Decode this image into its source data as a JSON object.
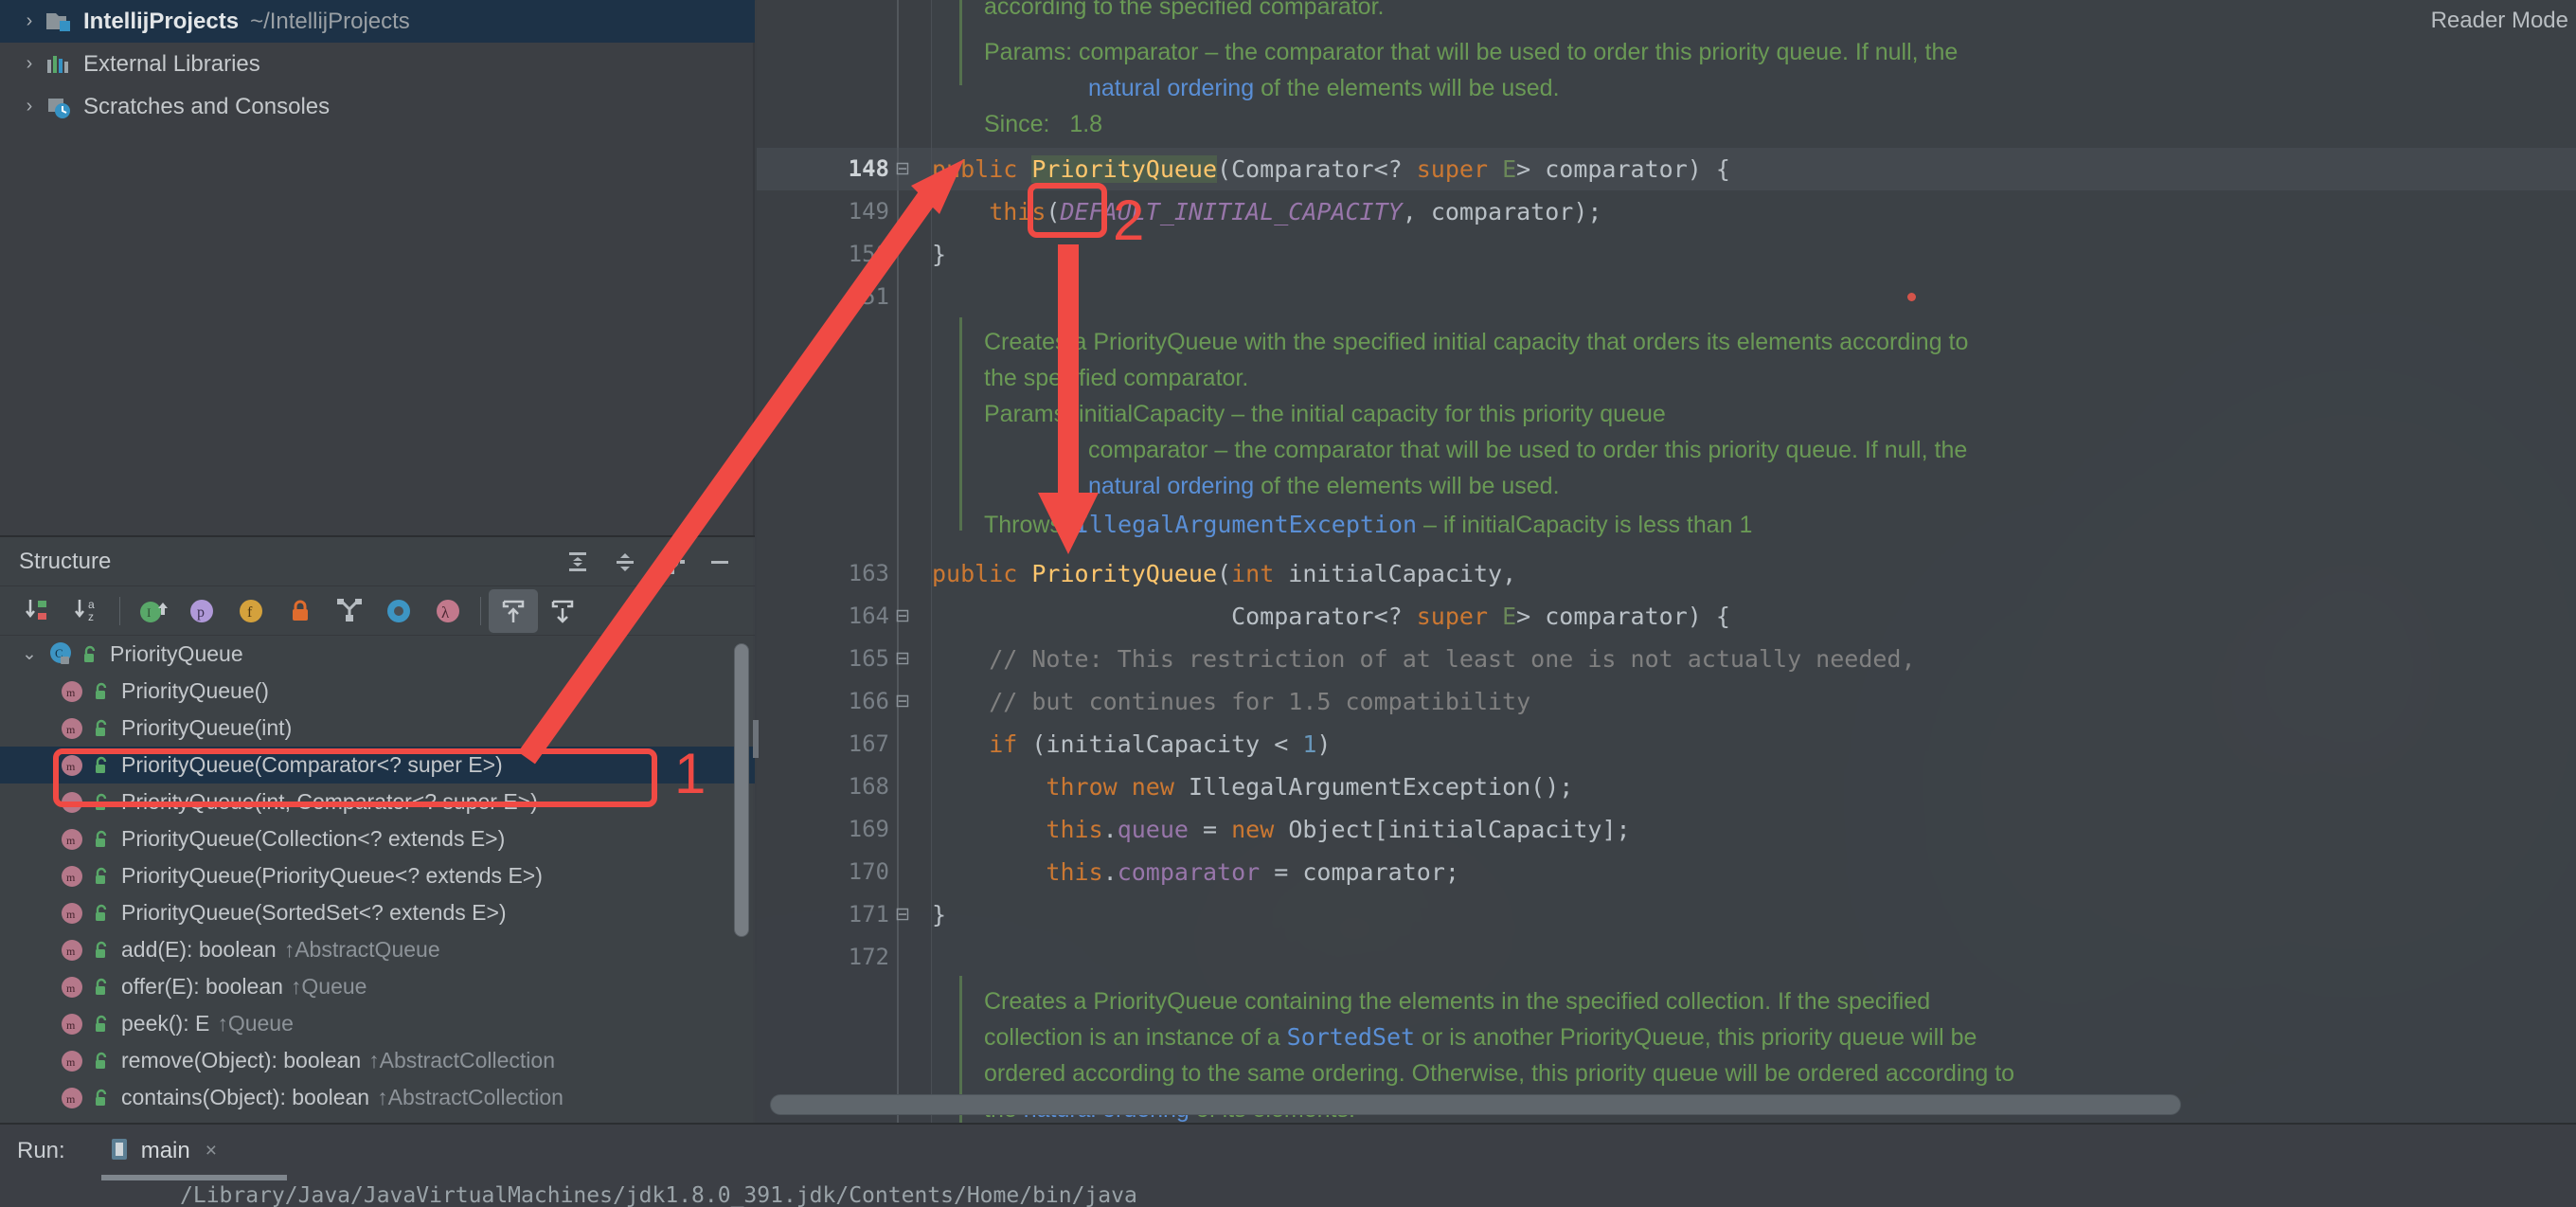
{
  "app": {
    "editor_reader_mode_label": "Reader Mode"
  },
  "project_tree": {
    "items": [
      {
        "label": "IntellijProjects",
        "path": "~/IntellijProjects",
        "icon": "project-folder-icon",
        "expanded": false,
        "selected": true
      },
      {
        "label": "External Libraries",
        "path": "",
        "icon": "libraries-icon",
        "expanded": false,
        "selected": false
      },
      {
        "label": "Scratches and Consoles",
        "path": "",
        "icon": "scratches-icon",
        "expanded": false,
        "selected": false
      }
    ]
  },
  "structure": {
    "title": "Structure",
    "header_buttons": [
      {
        "name": "expand-all-icon",
        "tooltip": "Expand All"
      },
      {
        "name": "collapse-all-icon",
        "tooltip": "Collapse All"
      },
      {
        "name": "gear-icon",
        "tooltip": "Settings"
      },
      {
        "name": "minimize-icon",
        "tooltip": "Hide"
      }
    ],
    "toolbar_buttons": [
      {
        "name": "sort-by-visibility-icon",
        "active": false
      },
      {
        "name": "sort-alphabetically-icon",
        "active": false
      },
      {
        "name": "show-inherited-icon",
        "active": false
      },
      {
        "name": "show-properties-icon",
        "active": false
      },
      {
        "name": "show-fields-icon",
        "active": false
      },
      {
        "name": "show-non-public-icon",
        "active": false
      },
      {
        "name": "group-methods-icon",
        "active": false
      },
      {
        "name": "show-anonymous-classes-icon",
        "active": false
      },
      {
        "name": "show-lambdas-icon",
        "active": false
      },
      {
        "name": "autoscroll-to-source-icon",
        "active": true
      },
      {
        "name": "autoscroll-from-source-icon",
        "active": false
      }
    ],
    "tree": [
      {
        "label": "PriorityQueue",
        "kind": "class",
        "depth": 0,
        "expanded": true,
        "selected": false,
        "inherited_from": ""
      },
      {
        "label": "PriorityQueue()",
        "kind": "method",
        "depth": 1,
        "selected": false,
        "inherited_from": ""
      },
      {
        "label": "PriorityQueue(int)",
        "kind": "method",
        "depth": 1,
        "selected": false,
        "inherited_from": ""
      },
      {
        "label": "PriorityQueue(Comparator<? super E>)",
        "kind": "method",
        "depth": 1,
        "selected": true,
        "inherited_from": ""
      },
      {
        "label": "PriorityQueue(int, Comparator<? super E>)",
        "kind": "method",
        "depth": 1,
        "selected": false,
        "inherited_from": ""
      },
      {
        "label": "PriorityQueue(Collection<? extends E>)",
        "kind": "method",
        "depth": 1,
        "selected": false,
        "inherited_from": ""
      },
      {
        "label": "PriorityQueue(PriorityQueue<? extends E>)",
        "kind": "method",
        "depth": 1,
        "selected": false,
        "inherited_from": ""
      },
      {
        "label": "PriorityQueue(SortedSet<? extends E>)",
        "kind": "method",
        "depth": 1,
        "selected": false,
        "inherited_from": ""
      },
      {
        "label": "add(E): boolean",
        "kind": "method",
        "depth": 1,
        "selected": false,
        "inherited_from": "↑AbstractQueue"
      },
      {
        "label": "offer(E): boolean",
        "kind": "method",
        "depth": 1,
        "selected": false,
        "inherited_from": "↑Queue"
      },
      {
        "label": "peek(): E",
        "kind": "method",
        "depth": 1,
        "selected": false,
        "inherited_from": "↑Queue"
      },
      {
        "label": "remove(Object): boolean",
        "kind": "method",
        "depth": 1,
        "selected": false,
        "inherited_from": "↑AbstractCollection"
      },
      {
        "label": "contains(Object): boolean",
        "kind": "method",
        "depth": 1,
        "selected": false,
        "inherited_from": "↑AbstractCollection"
      }
    ]
  },
  "run_panel": {
    "label": "Run:",
    "tab_name": "main",
    "tab_close": "×",
    "console_first_line": "/Library/Java/JavaVirtualMachines/jdk1.8.0_391.jdk/Contents/Home/bin/java"
  },
  "editor": {
    "doc_top": {
      "lines": [
        "according to the specified comparator.",
        "Params: comparator – the comparator that will be used to order this priority queue. If null, the",
        "natural ordering of the elements will be used.",
        "Since:  1.8"
      ],
      "link_text": "natural ordering",
      "since_label": "Since:",
      "since_value": "1.8"
    },
    "doc_middle": {
      "lines": [
        "Creates a PriorityQueue with the specified initial capacity that orders its elements according to",
        "the specified comparator.",
        "Params: initialCapacity – the initial capacity for this priority queue",
        "comparator – the comparator that will be used to order this priority queue. If null, the",
        "natural ordering of the elements will be used.",
        "Throws: IllegalArgumentException – if initialCapacity is less than 1"
      ],
      "link_text": "natural ordering",
      "throws_label": "Throws:",
      "throws_type": "IllegalArgumentException"
    },
    "doc_bottom": {
      "lines": [
        "Creates a PriorityQueue containing the elements in the specified collection. If the specified",
        "collection is an instance of a SortedSet or is another PriorityQueue, this priority queue will be",
        "ordered according to the same ordering. Otherwise, this priority queue will be ordered according to",
        "the natural ordering of its elements."
      ],
      "link_text": "SortedSet",
      "link_text_2": "natural ordering"
    },
    "code_lines": [
      {
        "n": "148",
        "current": true,
        "text": "public PriorityQueue(Comparator<? super E> comparator) {"
      },
      {
        "n": "149",
        "current": false,
        "text": "    this(DEFAULT_INITIAL_CAPACITY, comparator);"
      },
      {
        "n": "150",
        "current": false,
        "text": "}"
      },
      {
        "n": "151",
        "current": false,
        "text": ""
      },
      {
        "n": "163",
        "current": false,
        "text": "public PriorityQueue(int initialCapacity,"
      },
      {
        "n": "164",
        "current": false,
        "text": "                     Comparator<? super E> comparator) {"
      },
      {
        "n": "165",
        "current": false,
        "text": "    // Note: This restriction of at least one is not actually needed,"
      },
      {
        "n": "166",
        "current": false,
        "text": "    // but continues for 1.5 compatibility"
      },
      {
        "n": "167",
        "current": false,
        "text": "    if (initialCapacity < 1)"
      },
      {
        "n": "168",
        "current": false,
        "text": "        throw new IllegalArgumentException();"
      },
      {
        "n": "169",
        "current": false,
        "text": "        this.queue = new Object[initialCapacity];"
      },
      {
        "n": "170",
        "current": false,
        "text": "        this.comparator = comparator;"
      },
      {
        "n": "171",
        "current": false,
        "text": "}"
      },
      {
        "n": "172",
        "current": false,
        "text": ""
      }
    ]
  },
  "annotations": {
    "color": "#f04a44",
    "marker_1": "1",
    "marker_2": "2",
    "arrow_1_desc": "arrow from structure item PriorityQueue(Comparator<? super E>) to code line 148",
    "arrow_2_desc": "arrow from this(...) call down to constructor at line 163"
  }
}
